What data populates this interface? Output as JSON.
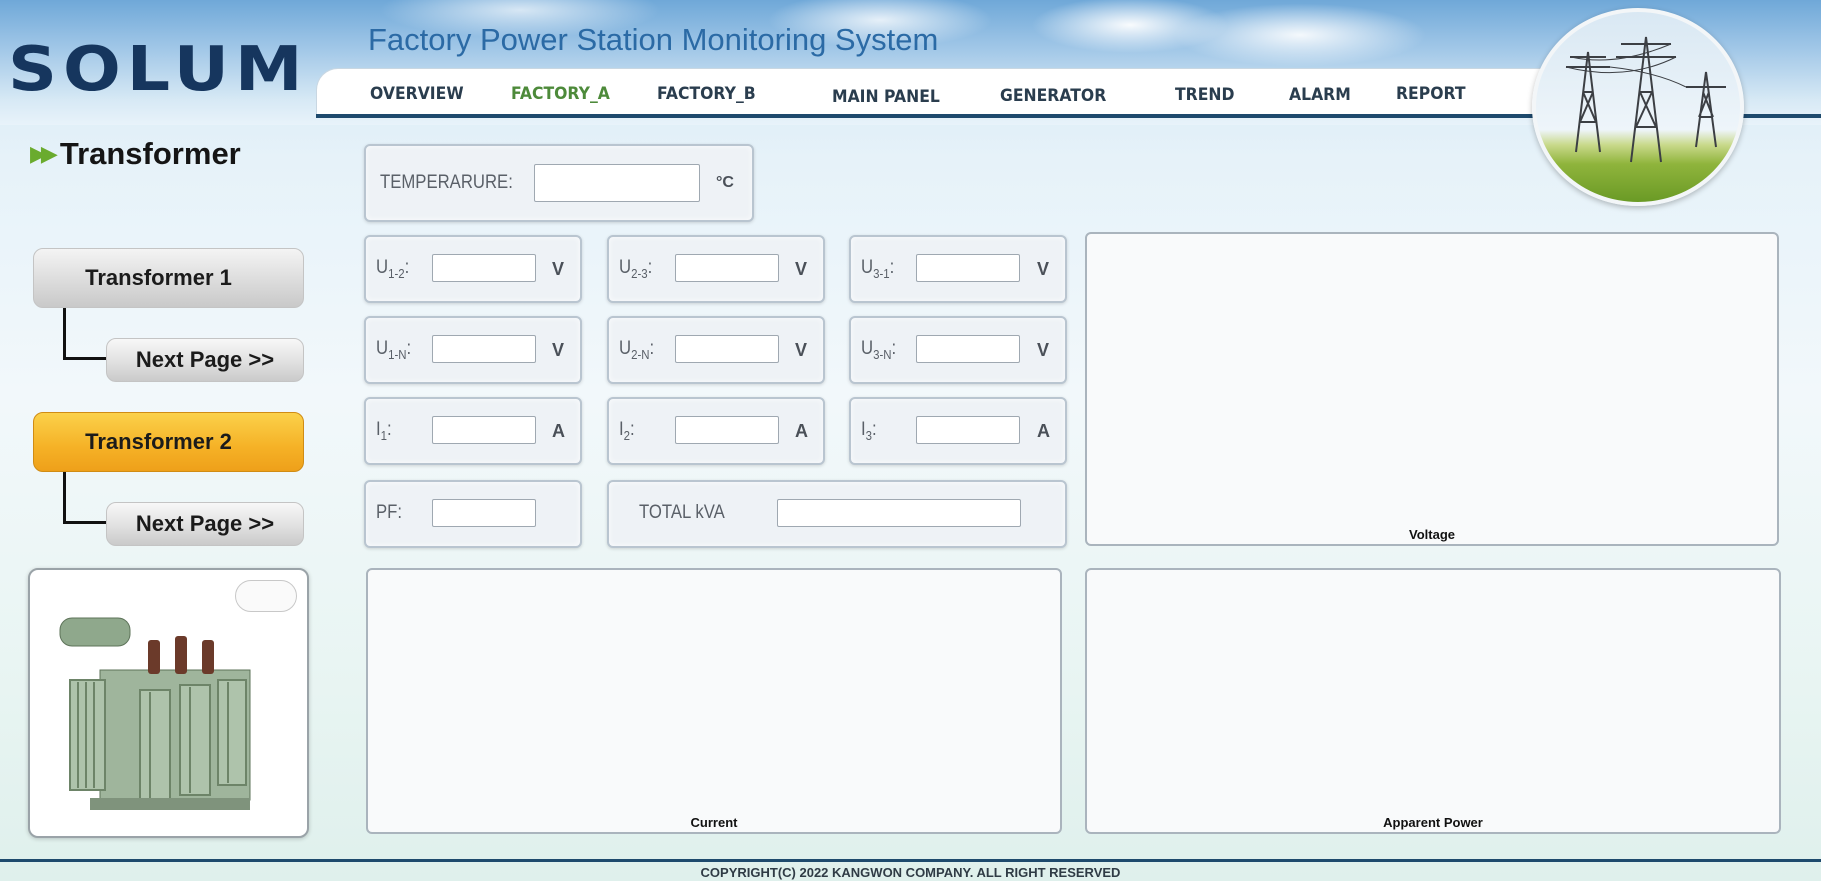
{
  "brand": {
    "logo_text": "SOLUM",
    "colors": {
      "navy": "#16365e",
      "accent_green": "#4d8a3a",
      "orange": "#f5b126"
    }
  },
  "header": {
    "title": "Factory Power Station Monitoring System",
    "nav": [
      {
        "label": "OVERVIEW",
        "active": false
      },
      {
        "label": "FACTORY_A",
        "active": true
      },
      {
        "label": "FACTORY_B",
        "active": false
      },
      {
        "label": "MAIN PANEL",
        "active": false
      },
      {
        "label": "GENERATOR",
        "active": false
      },
      {
        "label": "TREND",
        "active": false
      },
      {
        "label": "ALARM",
        "active": false
      },
      {
        "label": "REPORT",
        "active": false
      }
    ],
    "image_icon": "power-tower-photo"
  },
  "sidebar": {
    "section_title": "Transformer",
    "buttons": [
      {
        "label": "Transformer 1",
        "state": "inactive"
      },
      {
        "label": "Next Page >>"
      },
      {
        "label": "Transformer 2",
        "state": "selected"
      },
      {
        "label": "Next Page >>"
      }
    ],
    "image_icon": "transformer-photo"
  },
  "readings": {
    "temperature": {
      "label": "TEMPERARURE:",
      "value": "",
      "unit": "°C"
    },
    "voltage_ll": [
      {
        "label_main": "U",
        "label_sub": "1-2",
        "value": "",
        "unit": "V"
      },
      {
        "label_main": "U",
        "label_sub": "2-3",
        "value": "",
        "unit": "V"
      },
      {
        "label_main": "U",
        "label_sub": "3-1",
        "value": "",
        "unit": "V"
      }
    ],
    "voltage_ln": [
      {
        "label_main": "U",
        "label_sub": "1-N",
        "value": "",
        "unit": "V"
      },
      {
        "label_main": "U",
        "label_sub": "2-N",
        "value": "",
        "unit": "V"
      },
      {
        "label_main": "U",
        "label_sub": "3-N",
        "value": "",
        "unit": "V"
      }
    ],
    "current": [
      {
        "label_main": "I",
        "label_sub": "1",
        "value": "",
        "unit": "A"
      },
      {
        "label_main": "I",
        "label_sub": "2",
        "value": "",
        "unit": "A"
      },
      {
        "label_main": "I",
        "label_sub": "3",
        "value": "",
        "unit": "A"
      }
    ],
    "pf": {
      "label": "PF:",
      "value": ""
    },
    "total_kva": {
      "label": "TOTAL kVA",
      "value": ""
    }
  },
  "charts": {
    "voltage": "Voltage",
    "current": "Current",
    "apparent_power": "Apparent Power"
  },
  "footer": {
    "copyright": "COPYRIGHT(C) 2022 KANGWON COMPANY. ALL RIGHT RESERVED"
  }
}
